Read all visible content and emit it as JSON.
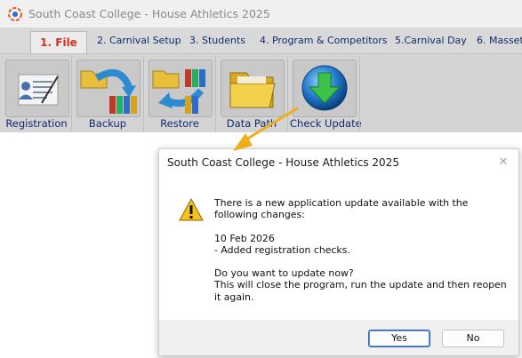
{
  "window": {
    "title": "South Coast College - House Athletics 2025"
  },
  "menu": {
    "tabs": [
      {
        "label": "1. File"
      },
      {
        "label": "2. Carnival Setup"
      },
      {
        "label": "3. Students"
      },
      {
        "label": "4. Program & Competitors"
      },
      {
        "label": "5.Carnival Day"
      },
      {
        "label": "6. Masset"
      }
    ],
    "active_tab": "1. File"
  },
  "toolbar": {
    "buttons": [
      {
        "label": "Registration",
        "icon": "registration-icon"
      },
      {
        "label": "Backup",
        "icon": "backup-icon"
      },
      {
        "label": "Restore",
        "icon": "restore-icon"
      },
      {
        "label": "Data Path",
        "icon": "folder-icon"
      },
      {
        "label": "Check Update",
        "icon": "globe-download-icon"
      }
    ]
  },
  "dialog": {
    "title": "South Coast College - House Athletics 2025",
    "message": {
      "intro_line1": "There is a new application update available with the",
      "intro_line2": "following changes:",
      "date": "10 Feb 2026",
      "change": "- Added registration checks.",
      "question": "Do you want to update now?",
      "detail_line1": "This will close the program, run the update and then reopen",
      "detail_line2": "it again."
    },
    "yes_label": "Yes",
    "no_label": "No",
    "close_glyph": "✕"
  },
  "colors": {
    "accent_arrow": "#f0ad1a",
    "active_tab_text": "#d6301f",
    "tab_text": "#0e2a6e",
    "ribbon_bg": "#d4d4d4"
  }
}
